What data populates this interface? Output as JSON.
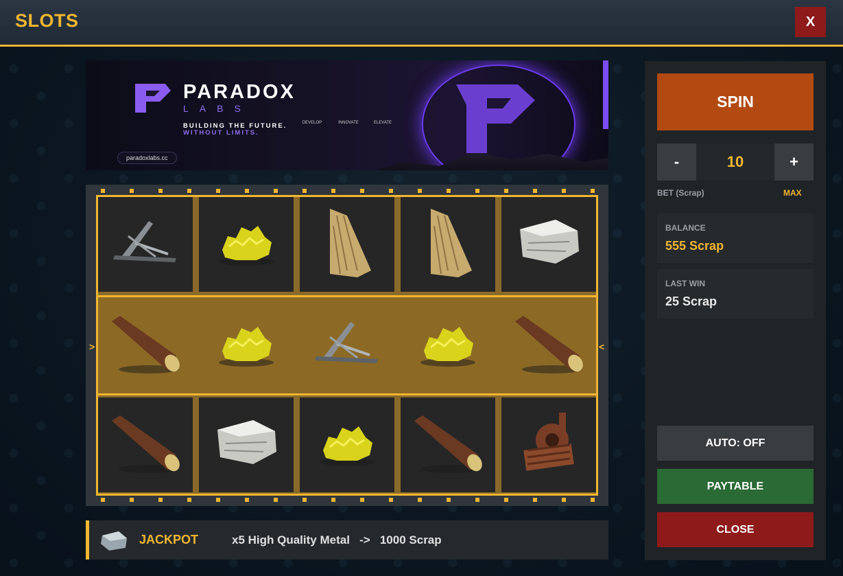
{
  "header": {
    "title": "SLOTS",
    "close_label": "X"
  },
  "banner": {
    "brand": "PARADOX",
    "brand_sub": "LABS",
    "tagline": "BUILDING THE FUTURE.",
    "tagline2": "WITHOUT LIMITS.",
    "pills": [
      "DEVELOP",
      "INNOVATE",
      "ELEVATE"
    ],
    "url": "paradoxlabs.cc",
    "accent": "#7b4cf0"
  },
  "reels": {
    "rows": [
      [
        "bone-fragments",
        "sulfur",
        "cloth",
        "cloth",
        "stones"
      ],
      [
        "wood",
        "sulfur",
        "bone-fragments",
        "sulfur",
        "wood"
      ],
      [
        "wood",
        "stones",
        "sulfur",
        "wood",
        "metal-fragments"
      ]
    ],
    "winning_row": 1,
    "left_arrow": ">",
    "right_arrow": "<"
  },
  "jackpot": {
    "label": "JACKPOT",
    "description": "x5 High Quality Metal   ->   1000 Scrap",
    "icon": "high-quality-metal-icon"
  },
  "panel": {
    "spin_label": "SPIN",
    "minus_label": "-",
    "plus_label": "+",
    "bet_value": "10",
    "bet_label": "BET (Scrap)",
    "max_label": "MAX",
    "balance_label": "BALANCE",
    "balance_value": "555 Scrap",
    "last_win_label": "LAST WIN",
    "last_win_value": "25 Scrap",
    "auto_label": "AUTO: OFF",
    "paytable_label": "PAYTABLE",
    "close_label": "CLOSE"
  },
  "colors": {
    "accent": "#f2b631",
    "spin": "#b24a12",
    "paytable": "#2a6a34",
    "close": "#8e1a1a"
  }
}
